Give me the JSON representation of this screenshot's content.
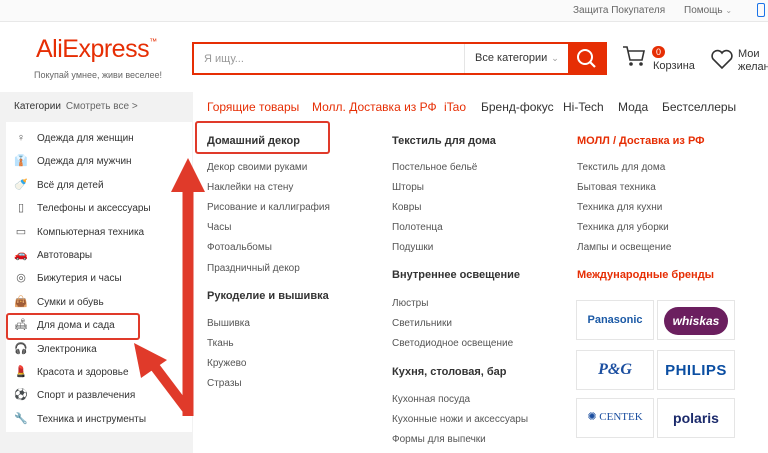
{
  "topbar": {
    "protection": "Защита Покупателя",
    "help": "Помощь"
  },
  "header": {
    "logo": "AliExpress",
    "slogan": "Покупай умнее, живи веселее!",
    "search_placeholder": "Я ищу...",
    "category_select": "Все категории",
    "cart_count": "0",
    "cart_label": "Корзина",
    "wish_label": "Мои желания"
  },
  "sidebar": {
    "title": "Категории",
    "see_all": "Смотреть все >",
    "items": [
      {
        "label": "Одежда для женщин",
        "icon": "dress-icon",
        "glyph": "♀"
      },
      {
        "label": "Одежда для мужчин",
        "icon": "shirt-icon",
        "glyph": "👔"
      },
      {
        "label": "Всё для детей",
        "icon": "bottle-icon",
        "glyph": "🍼"
      },
      {
        "label": "Телефоны и аксессуары",
        "icon": "phone-icon",
        "glyph": "▯"
      },
      {
        "label": "Компьютерная техника",
        "icon": "computer-icon",
        "glyph": "▭"
      },
      {
        "label": "Автотовары",
        "icon": "car-icon",
        "glyph": "🚗"
      },
      {
        "label": "Бижутерия и часы",
        "icon": "ring-icon",
        "glyph": "◎"
      },
      {
        "label": "Сумки и обувь",
        "icon": "bag-icon",
        "glyph": "👜"
      },
      {
        "label": "Для дома и сада",
        "icon": "sofa-icon",
        "glyph": "🛋"
      },
      {
        "label": "Электроника",
        "icon": "headphones-icon",
        "glyph": "🎧"
      },
      {
        "label": "Красота и здоровье",
        "icon": "lipstick-icon",
        "glyph": "💄"
      },
      {
        "label": "Спорт и развлечения",
        "icon": "ball-icon",
        "glyph": "⚽"
      },
      {
        "label": "Техника и инструменты",
        "icon": "tools-icon",
        "glyph": "🔧"
      }
    ]
  },
  "nav": {
    "items": [
      "Горящие товары",
      "Молл. Доставка из РФ",
      "iTao",
      "Бренд-фокус",
      "Hi-Tech",
      "Мода",
      "Бестселлеры"
    ]
  },
  "content": {
    "col1": {
      "title1": "Домашний декор",
      "links1": [
        "Декор своими руками",
        "Наклейки на стену",
        "Рисование и каллиграфия",
        "Часы",
        "Фотоальбомы",
        "Праздничный декор"
      ],
      "title2": "Рукоделие и вышивка",
      "links2": [
        "Вышивка",
        "Ткань",
        "Кружево",
        "Стразы"
      ]
    },
    "col2": {
      "title1": "Текстиль для дома",
      "links1": [
        "Постельное бельё",
        "Шторы",
        "Ковры",
        "Полотенца",
        "Подушки"
      ],
      "title2": "Внутреннее освещение",
      "links2": [
        "Люстры",
        "Светильники",
        "Светодиодное освещение"
      ],
      "title3": "Кухня, столовая, бар",
      "links3": [
        "Кухонная посуда",
        "Кухонные ножи и аксессуары",
        "Формы для выпечки"
      ]
    },
    "col3": {
      "title1": "МОЛЛ / Доставка из РФ",
      "links1": [
        "Текстиль для дома",
        "Бытовая техника",
        "Техника для кухни",
        "Техника для уборки",
        "Лампы и освещение"
      ],
      "title2": "Международные бренды"
    },
    "brands": [
      "Panasonic",
      "whiskas",
      "P&G",
      "PHILIPS",
      "CENTEK",
      "polaris"
    ]
  },
  "colors": {
    "accent": "#e62e04",
    "highlight": "#e03a2a",
    "link_red": "#e62e04"
  }
}
